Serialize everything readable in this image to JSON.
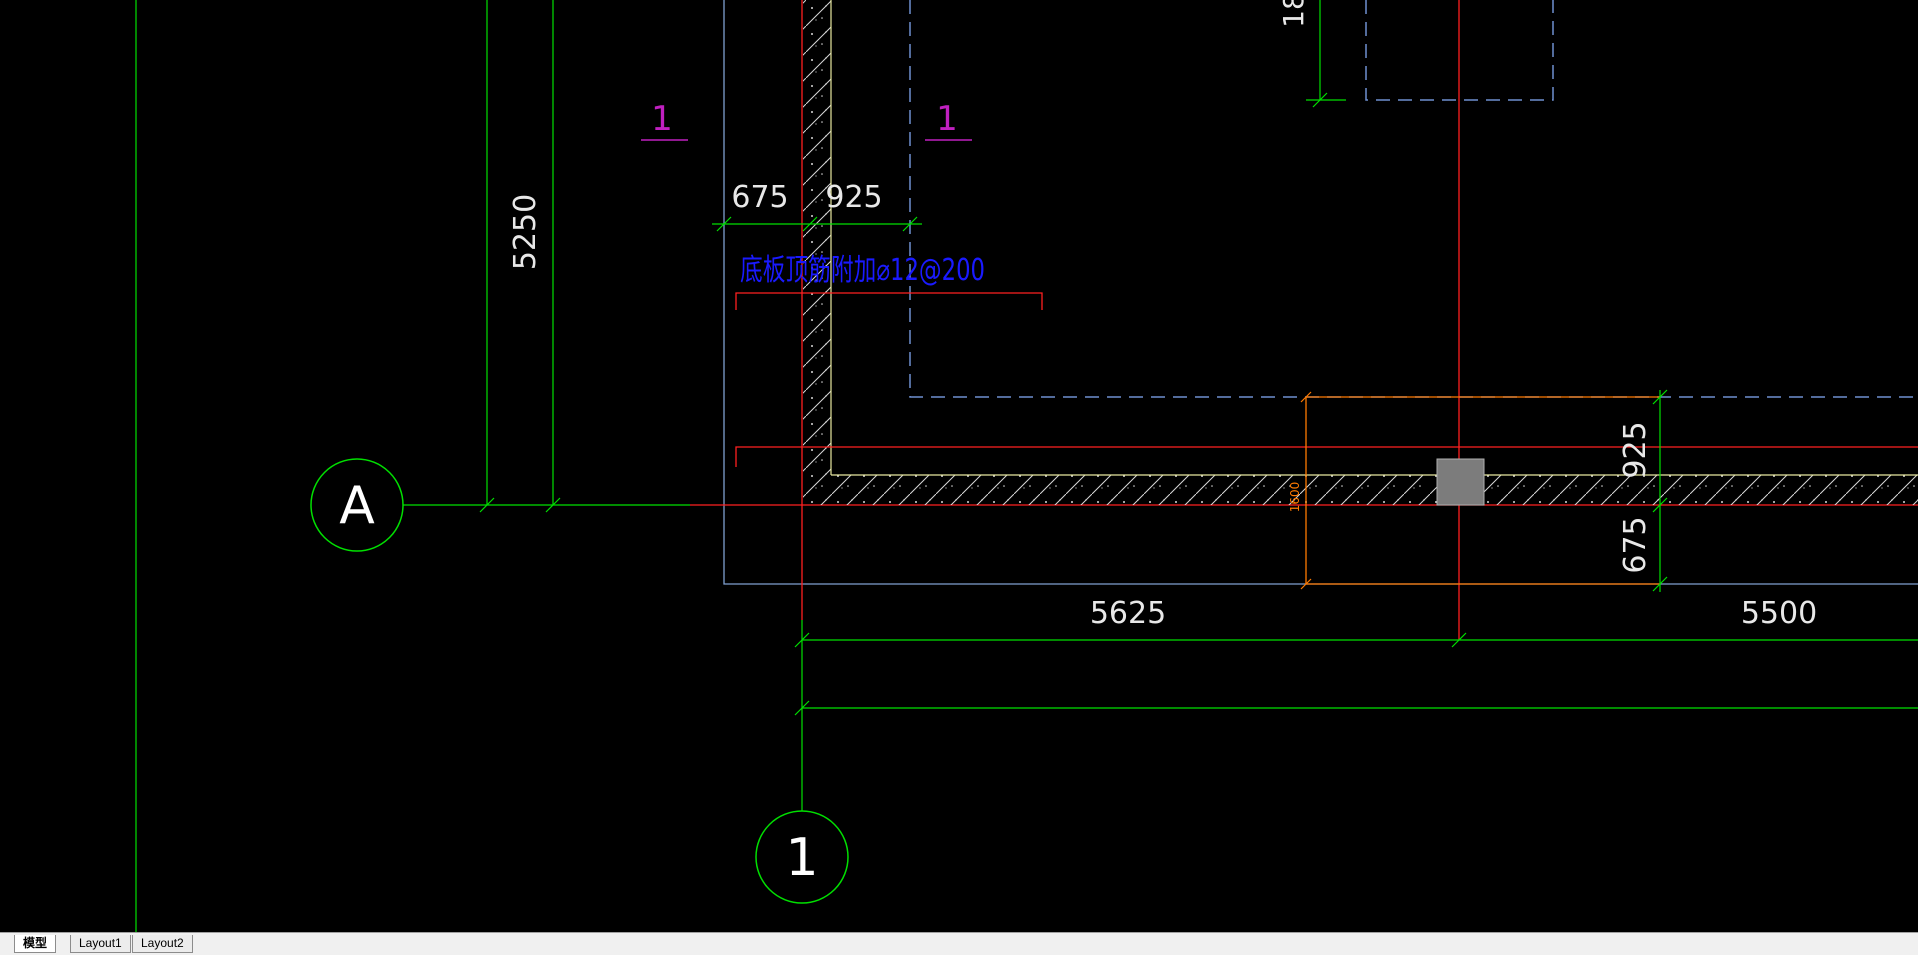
{
  "drawing": {
    "dimensions": {
      "d5250": "5250",
      "d675_top": "675",
      "d925_top": "925",
      "d925_right": "925",
      "d675_right": "675",
      "d5625": "5625",
      "d5500": "5500",
      "d18": "18",
      "d1600": "1600"
    },
    "section_marks": {
      "left": "1",
      "right": "1"
    },
    "annotation": "底板顶筋附加⌀12@200",
    "axes": {
      "row_a": "A",
      "col_1": "1"
    },
    "colors": {
      "dimension": "#00e000",
      "axis": "#ff2020",
      "outline": "#7f9fcf",
      "dashed": "#6f8fcf",
      "hatch": "#e8e8e8",
      "note": "#1a1aff",
      "section": "#c020c0",
      "orange": "#ff7a00"
    }
  },
  "tabs": [
    {
      "label": "模型",
      "active": true
    },
    {
      "label": "Layout1",
      "active": false
    },
    {
      "label": "Layout2",
      "active": false
    }
  ]
}
